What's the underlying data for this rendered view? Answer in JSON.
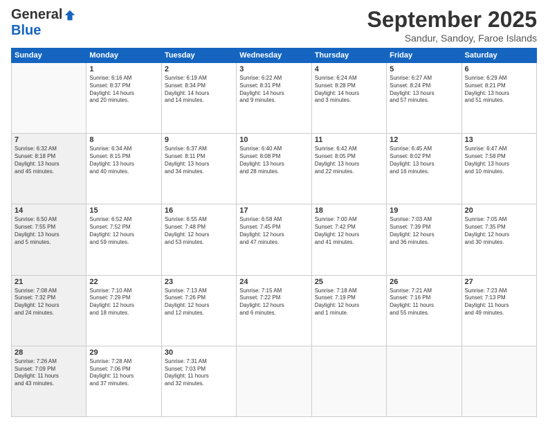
{
  "logo": {
    "general": "General",
    "blue": "Blue"
  },
  "header": {
    "month": "September 2025",
    "location": "Sandur, Sandoy, Faroe Islands"
  },
  "days_of_week": [
    "Sunday",
    "Monday",
    "Tuesday",
    "Wednesday",
    "Thursday",
    "Friday",
    "Saturday"
  ],
  "weeks": [
    [
      {
        "day": "",
        "info": ""
      },
      {
        "day": "1",
        "info": "Sunrise: 6:16 AM\nSunset: 8:37 PM\nDaylight: 14 hours\nand 20 minutes."
      },
      {
        "day": "2",
        "info": "Sunrise: 6:19 AM\nSunset: 8:34 PM\nDaylight: 14 hours\nand 14 minutes."
      },
      {
        "day": "3",
        "info": "Sunrise: 6:22 AM\nSunset: 8:31 PM\nDaylight: 14 hours\nand 9 minutes."
      },
      {
        "day": "4",
        "info": "Sunrise: 6:24 AM\nSunset: 8:28 PM\nDaylight: 14 hours\nand 3 minutes."
      },
      {
        "day": "5",
        "info": "Sunrise: 6:27 AM\nSunset: 8:24 PM\nDaylight: 13 hours\nand 57 minutes."
      },
      {
        "day": "6",
        "info": "Sunrise: 6:29 AM\nSunset: 8:21 PM\nDaylight: 13 hours\nand 51 minutes."
      }
    ],
    [
      {
        "day": "7",
        "info": "Sunrise: 6:32 AM\nSunset: 8:18 PM\nDaylight: 13 hours\nand 45 minutes."
      },
      {
        "day": "8",
        "info": "Sunrise: 6:34 AM\nSunset: 8:15 PM\nDaylight: 13 hours\nand 40 minutes."
      },
      {
        "day": "9",
        "info": "Sunrise: 6:37 AM\nSunset: 8:11 PM\nDaylight: 13 hours\nand 34 minutes."
      },
      {
        "day": "10",
        "info": "Sunrise: 6:40 AM\nSunset: 8:08 PM\nDaylight: 13 hours\nand 28 minutes."
      },
      {
        "day": "11",
        "info": "Sunrise: 6:42 AM\nSunset: 8:05 PM\nDaylight: 13 hours\nand 22 minutes."
      },
      {
        "day": "12",
        "info": "Sunrise: 6:45 AM\nSunset: 8:02 PM\nDaylight: 13 hours\nand 16 minutes."
      },
      {
        "day": "13",
        "info": "Sunrise: 6:47 AM\nSunset: 7:58 PM\nDaylight: 13 hours\nand 10 minutes."
      }
    ],
    [
      {
        "day": "14",
        "info": "Sunrise: 6:50 AM\nSunset: 7:55 PM\nDaylight: 13 hours\nand 5 minutes."
      },
      {
        "day": "15",
        "info": "Sunrise: 6:52 AM\nSunset: 7:52 PM\nDaylight: 12 hours\nand 59 minutes."
      },
      {
        "day": "16",
        "info": "Sunrise: 6:55 AM\nSunset: 7:48 PM\nDaylight: 12 hours\nand 53 minutes."
      },
      {
        "day": "17",
        "info": "Sunrise: 6:58 AM\nSunset: 7:45 PM\nDaylight: 12 hours\nand 47 minutes."
      },
      {
        "day": "18",
        "info": "Sunrise: 7:00 AM\nSunset: 7:42 PM\nDaylight: 12 hours\nand 41 minutes."
      },
      {
        "day": "19",
        "info": "Sunrise: 7:03 AM\nSunset: 7:39 PM\nDaylight: 12 hours\nand 36 minutes."
      },
      {
        "day": "20",
        "info": "Sunrise: 7:05 AM\nSunset: 7:35 PM\nDaylight: 12 hours\nand 30 minutes."
      }
    ],
    [
      {
        "day": "21",
        "info": "Sunrise: 7:08 AM\nSunset: 7:32 PM\nDaylight: 12 hours\nand 24 minutes."
      },
      {
        "day": "22",
        "info": "Sunrise: 7:10 AM\nSunset: 7:29 PM\nDaylight: 12 hours\nand 18 minutes."
      },
      {
        "day": "23",
        "info": "Sunrise: 7:13 AM\nSunset: 7:26 PM\nDaylight: 12 hours\nand 12 minutes."
      },
      {
        "day": "24",
        "info": "Sunrise: 7:15 AM\nSunset: 7:22 PM\nDaylight: 12 hours\nand 6 minutes."
      },
      {
        "day": "25",
        "info": "Sunrise: 7:18 AM\nSunset: 7:19 PM\nDaylight: 12 hours\nand 1 minute."
      },
      {
        "day": "26",
        "info": "Sunrise: 7:21 AM\nSunset: 7:16 PM\nDaylight: 11 hours\nand 55 minutes."
      },
      {
        "day": "27",
        "info": "Sunrise: 7:23 AM\nSunset: 7:13 PM\nDaylight: 11 hours\nand 49 minutes."
      }
    ],
    [
      {
        "day": "28",
        "info": "Sunrise: 7:26 AM\nSunset: 7:09 PM\nDaylight: 11 hours\nand 43 minutes."
      },
      {
        "day": "29",
        "info": "Sunrise: 7:28 AM\nSunset: 7:06 PM\nDaylight: 11 hours\nand 37 minutes."
      },
      {
        "day": "30",
        "info": "Sunrise: 7:31 AM\nSunset: 7:03 PM\nDaylight: 11 hours\nand 32 minutes."
      },
      {
        "day": "",
        "info": ""
      },
      {
        "day": "",
        "info": ""
      },
      {
        "day": "",
        "info": ""
      },
      {
        "day": "",
        "info": ""
      }
    ]
  ]
}
